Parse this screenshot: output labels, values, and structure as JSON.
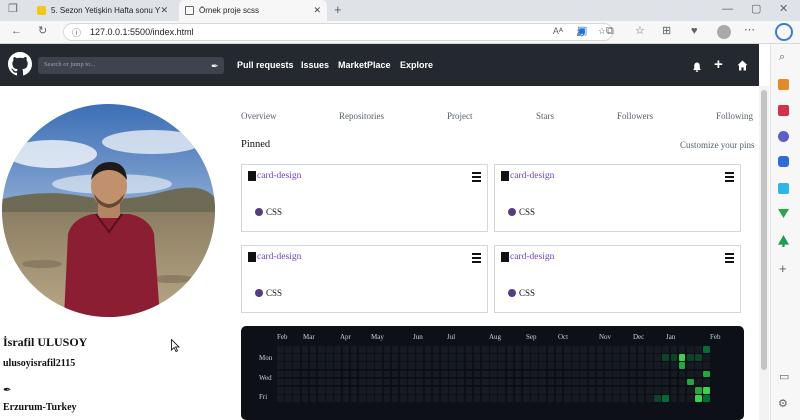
{
  "browser": {
    "tabs": [
      {
        "title": "5. Sezon Yetişkin Hafta sonu Yazı"
      },
      {
        "title": "Örnek proje scss"
      }
    ],
    "new_tab_symbol": "+",
    "address": "127.0.0.1:5500/index.html"
  },
  "header": {
    "search_placeholder": "Search or jump to...",
    "nav": [
      "Pull requests",
      "Issues",
      "MarketPlace",
      "Explore"
    ]
  },
  "profile": {
    "name": "İsrafil ULUSOY",
    "username": "ulusoyisrafil2115",
    "location": "Erzurum-Turkey"
  },
  "tabs": [
    "Overview",
    "Repositories",
    "Project",
    "Stars",
    "Followers",
    "Following"
  ],
  "pinned": {
    "title": "Pinned",
    "customize": "Customize your pins",
    "cards": [
      {
        "repo": "card-design",
        "language": "CSS",
        "lang_color": "#563d7c"
      },
      {
        "repo": "card-design",
        "language": "CSS",
        "lang_color": "#563d7c"
      },
      {
        "repo": "card-design",
        "language": "CSS",
        "lang_color": "#563d7c"
      },
      {
        "repo": "card-design",
        "language": "CSS",
        "lang_color": "#563d7c"
      }
    ]
  },
  "contributions": {
    "months": [
      "Feb",
      "Mar",
      "Apr",
      "May",
      "Jun",
      "Jul",
      "Aug",
      "Sep",
      "Oct",
      "Nov",
      "Dec",
      "Jan",
      "Feb"
    ],
    "days": [
      "Mon",
      "Wed",
      "Fri"
    ],
    "colors": [
      "#161b22",
      "#0e4429",
      "#006d32",
      "#26a641",
      "#39d353"
    ]
  }
}
